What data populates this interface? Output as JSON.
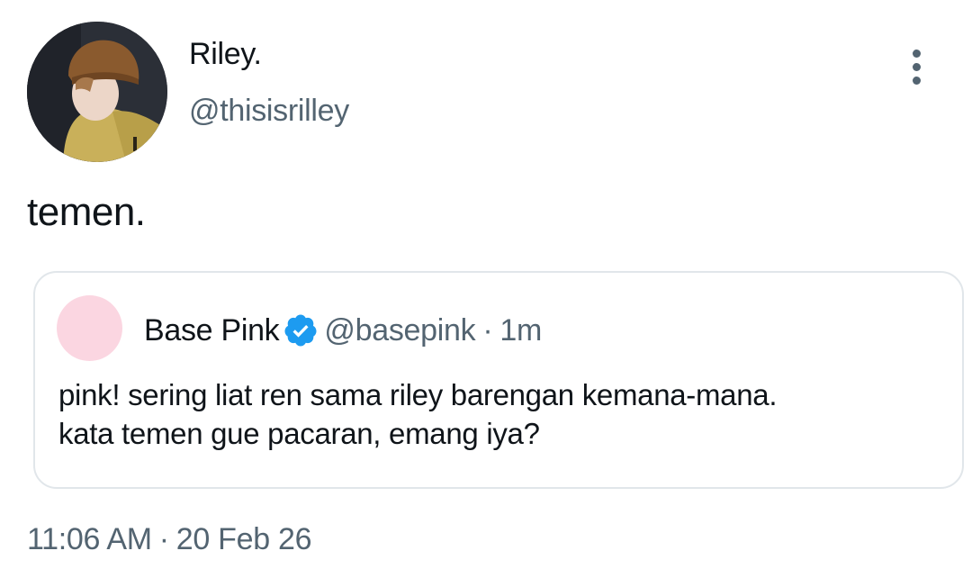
{
  "author": {
    "display_name": "Riley.",
    "handle": "@thisisrilley",
    "avatar_icon": "profile-photo"
  },
  "tweet": {
    "text": "temen.",
    "time": "11:06 AM",
    "separator": "·",
    "date": "20 Feb 26"
  },
  "quoted_tweet": {
    "display_name": "Base Pink",
    "verified_icon": "verified-badge-icon",
    "handle": "@basepink",
    "separator": "·",
    "time": "1m",
    "text_line1": "pink! sering liat ren sama riley barengan kemana-mana.",
    "text_line2": "kata temen gue pacaran, emang iya?",
    "avatar_color": "#fbd6e1"
  },
  "colors": {
    "primary_text": "#0f1419",
    "secondary_text": "#536471",
    "verified_blue": "#1d9bf0",
    "border": "#e1e6ea"
  }
}
